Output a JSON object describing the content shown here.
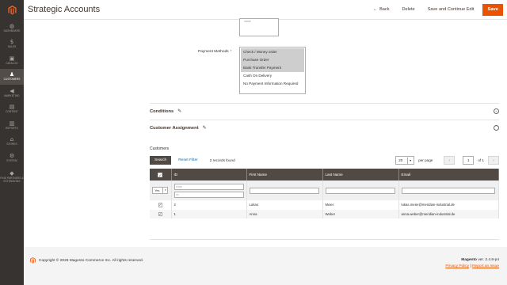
{
  "nav": {
    "items": [
      {
        "icon": "dashboard-icon",
        "glyph": "◍",
        "label": "DASHBOARD"
      },
      {
        "icon": "sales-icon",
        "glyph": "$",
        "label": "SALES"
      },
      {
        "icon": "catalog-icon",
        "glyph": "▣",
        "label": "CATALOG"
      },
      {
        "icon": "customers-icon",
        "glyph": "♟",
        "label": "CUSTOMERS"
      },
      {
        "icon": "marketing-icon",
        "glyph": "◀",
        "label": "MARKETING"
      },
      {
        "icon": "content-icon",
        "glyph": "▤",
        "label": "CONTENT"
      },
      {
        "icon": "reports-icon",
        "glyph": "▥",
        "label": "REPORTS"
      },
      {
        "icon": "stores-icon",
        "glyph": "⌂",
        "label": "STORES"
      },
      {
        "icon": "system-icon",
        "glyph": "⚙",
        "label": "SYSTEM"
      },
      {
        "icon": "extensions-icon",
        "glyph": "◆",
        "label": "FIND PARTNERS & EXTENSIONS"
      }
    ]
  },
  "header": {
    "title": "Strategic Accounts",
    "back_label": "Back",
    "delete_label": "Delete",
    "save_continue_label": "Save and Continue Edit",
    "save_label": "Save"
  },
  "form": {
    "textarea_placeholder": "name",
    "payment_methods_label": "Payment Methods",
    "payment_methods": [
      {
        "label": "Check / Money order",
        "selected": true
      },
      {
        "label": "Purchase Order",
        "selected": true
      },
      {
        "label": "Bank Transfer Payment",
        "selected": true
      },
      {
        "label": "Cash On Delivery",
        "selected": false
      },
      {
        "label": "No Payment Information Required",
        "selected": false
      }
    ]
  },
  "sections": {
    "conditions": "Conditions",
    "customer_assignment": "Customer Assignment"
  },
  "customers": {
    "title": "Customers",
    "search_label": "Search",
    "reset_label": "Reset Filter",
    "records_found": "2 records found",
    "per_page": "20",
    "per_page_label": "per page",
    "page": "1",
    "page_of": "of 1",
    "filter_yes": "Yes",
    "filter_from": "from",
    "filter_to": "to",
    "columns": [
      "ID",
      "First Name",
      "Last Name",
      "Email"
    ],
    "rows": [
      {
        "id": "2",
        "first": "Lukas",
        "last": "Meier",
        "email": "lukas.meier@meridian-industrial.de"
      },
      {
        "id": "1",
        "first": "Anna",
        "last": "Weber",
        "email": "anna.weber@meridian-industrial.de"
      }
    ]
  },
  "footer": {
    "copyright": "Copyright © 2026 Magento Commerce Inc. All rights reserved.",
    "brand": "Magento",
    "version": " ver. 2.4.8-p4",
    "privacy": "Privacy Policy",
    "separator": " | ",
    "report": "Report an Issue"
  },
  "colors": {
    "accent": "#eb5202",
    "nav_bg": "#373330",
    "grid_header": "#514943",
    "link": "#006bb4"
  }
}
